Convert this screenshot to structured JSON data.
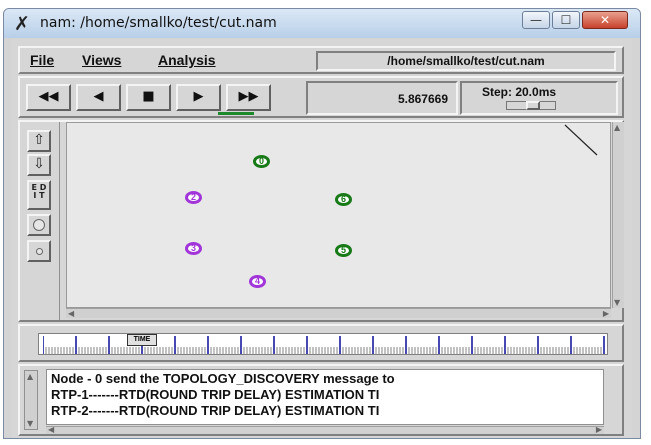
{
  "window": {
    "title": "nam: /home/smallko/test/cut.nam",
    "icon": "x-icon",
    "minimize_label": "—",
    "maximize_label": "☐",
    "close_label": "✕"
  },
  "menubar": {
    "items": [
      {
        "label": "File",
        "underline": "F"
      },
      {
        "label": "Views",
        "underline": "V"
      },
      {
        "label": "Analysis",
        "underline": "A"
      }
    ],
    "file_path": "/home/smallko/test/cut.nam"
  },
  "controls": {
    "buttons": [
      {
        "name": "rewind-fast",
        "glyph": "◀◀"
      },
      {
        "name": "rewind",
        "glyph": "◀"
      },
      {
        "name": "stop",
        "glyph": "■"
      },
      {
        "name": "play",
        "glyph": "▶"
      },
      {
        "name": "fast-forward",
        "glyph": "▶▶"
      }
    ],
    "time": "5.867669",
    "step_label": "Step: 20.0ms"
  },
  "toolbar": {
    "zoom_in_glyph": "⇧",
    "zoom_out_glyph": "⇩",
    "edit_label": "E D\nI T"
  },
  "nodes": [
    {
      "id": "0",
      "color": "#177a17"
    },
    {
      "id": "2",
      "color": "#a235d9"
    },
    {
      "id": "6",
      "color": "#177a17"
    },
    {
      "id": "3",
      "color": "#a235d9"
    },
    {
      "id": "5",
      "color": "#177a17"
    },
    {
      "id": "4",
      "color": "#a235d9"
    }
  ],
  "timeline": {
    "marker_label": "TIME"
  },
  "log": {
    "lines": [
      "Node - 0 send the TOPOLOGY_DISCOVERY message to",
      "RTP-1-------RTD(ROUND TRIP DELAY) ESTIMATION TI",
      "RTP-2-------RTD(ROUND TRIP DELAY) ESTIMATION TI"
    ]
  },
  "colors": {
    "panel": "#d6d6d6",
    "canvas": "#e8e8e8",
    "play_indicator": "#1c8a2a",
    "timeline_tick": "#1a1aa0"
  }
}
